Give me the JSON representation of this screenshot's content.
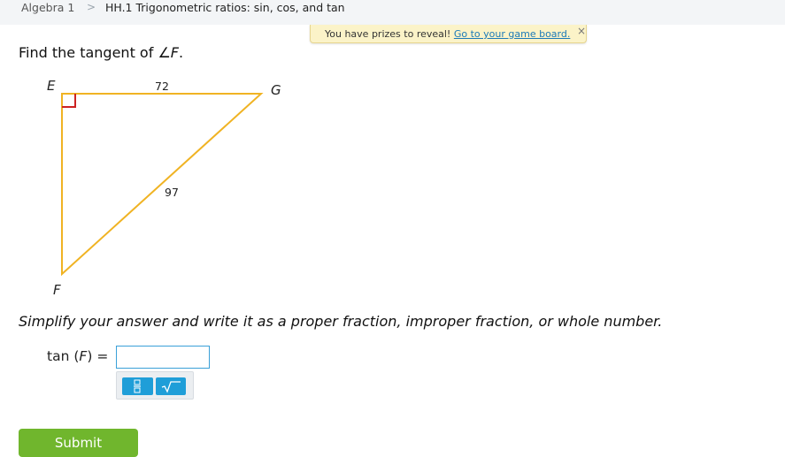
{
  "breadcrumb": {
    "course": "Algebra 1",
    "separator": ">",
    "skill": "HH.1 Trigonometric ratios: sin, cos, and tan"
  },
  "prize_banner": {
    "text": "You have prizes to reveal!",
    "link": "Go to your game board.",
    "close": "×"
  },
  "question": {
    "prefix": "Find the tangent of ",
    "angle": "∠F",
    "suffix": "."
  },
  "diagram": {
    "vertex_e": "E",
    "vertex_g": "G",
    "vertex_f": "F",
    "side_eg": "72",
    "side_fg": "97",
    "line_color": "#f0b323",
    "right_angle_color": "#cc2222"
  },
  "instruction": "Simplify your answer and write it as a proper fraction, improper fraction, or whole number.",
  "answer": {
    "fn": "tan",
    "var": "F",
    "equals": "=",
    "value": ""
  },
  "toolbar": {
    "fraction_icon": "fraction-icon",
    "sqrt_icon": "square-root-icon"
  },
  "submit": {
    "label": "Submit"
  },
  "colors": {
    "accent": "#1f9ed8",
    "submit": "#70b62d",
    "banner": "#fbf3c8"
  }
}
